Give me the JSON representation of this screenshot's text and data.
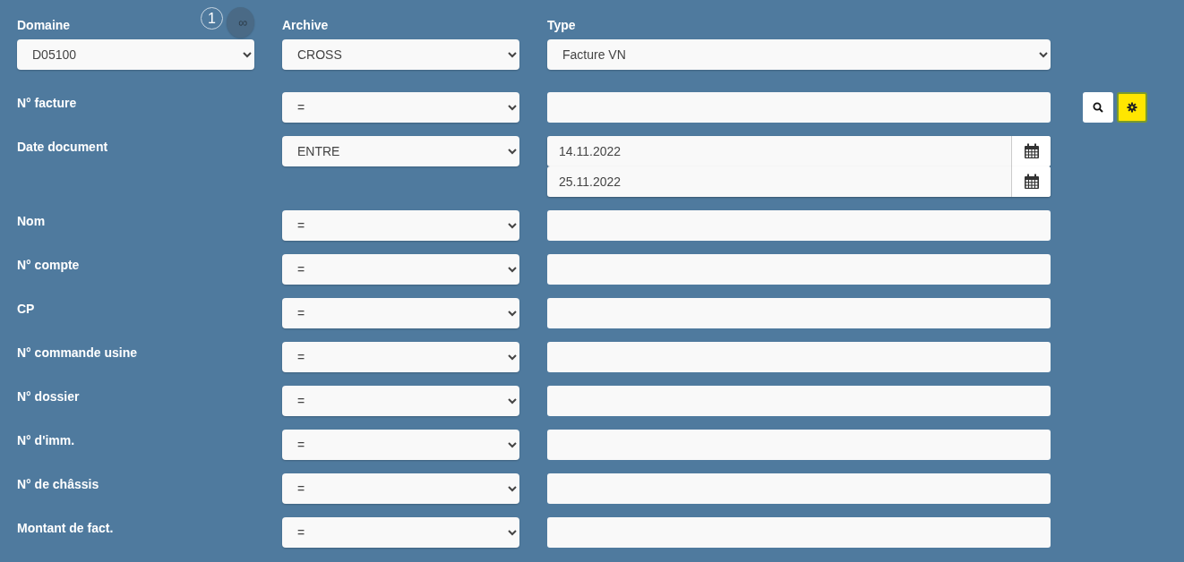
{
  "limit_options": [
    {
      "label": "1",
      "selected": false
    },
    {
      "label": "∞",
      "selected": true
    }
  ],
  "top_fields": [
    {
      "label": "Domaine",
      "value": "D05100"
    },
    {
      "label": "Archive",
      "value": "CROSS"
    },
    {
      "label": "Type",
      "value": "Facture VN"
    }
  ],
  "filters": [
    {
      "label": "N° facture",
      "kind": "text",
      "operator": "="
    },
    {
      "label": "Date document",
      "kind": "date_range",
      "operator": "ENTRE",
      "dates": [
        "14.11.2022",
        "25.11.2022"
      ]
    },
    {
      "label": "Nom",
      "kind": "text",
      "operator": "="
    },
    {
      "label": "N° compte",
      "kind": "text",
      "operator": "="
    },
    {
      "label": "CP",
      "kind": "text",
      "operator": "="
    },
    {
      "label": "N° commande usine",
      "kind": "text",
      "operator": "="
    },
    {
      "label": "N° dossier",
      "kind": "text",
      "operator": "="
    },
    {
      "label": "N° d'imm.",
      "kind": "text",
      "operator": "="
    },
    {
      "label": "N° de châssis",
      "kind": "text",
      "operator": "="
    },
    {
      "label": "Montant de fact.",
      "kind": "text",
      "operator": "="
    }
  ],
  "actions": [
    {
      "kind": "search",
      "highlighted": false
    },
    {
      "kind": "settings",
      "highlighted": true
    }
  ]
}
